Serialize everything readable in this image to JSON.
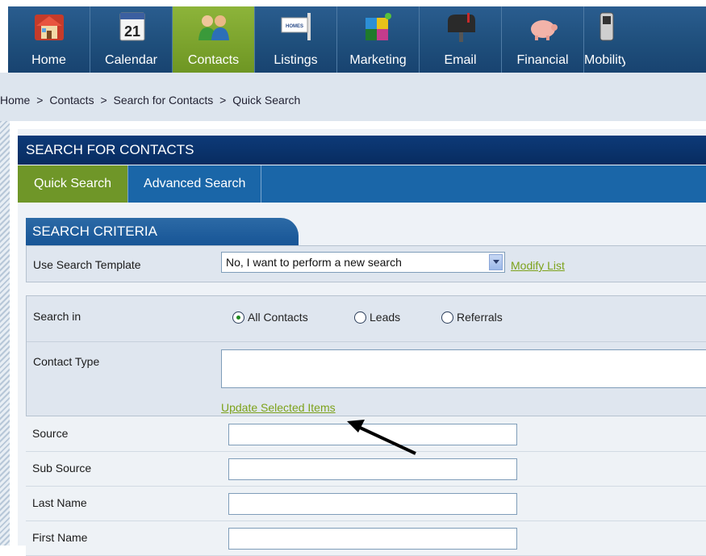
{
  "nav": [
    {
      "label": "Home",
      "icon": "house-icon"
    },
    {
      "label": "Calendar",
      "icon": "calendar-icon",
      "badge": "21"
    },
    {
      "label": "Contacts",
      "icon": "people-icon",
      "active": true
    },
    {
      "label": "Listings",
      "icon": "homes-sign-icon",
      "sign_text": "HOMES"
    },
    {
      "label": "Marketing",
      "icon": "puzzle-icon"
    },
    {
      "label": "Email",
      "icon": "mailbox-icon"
    },
    {
      "label": "Financial",
      "icon": "piggy-bank-icon"
    },
    {
      "label": "Mobility",
      "icon": "phone-icon"
    }
  ],
  "breadcrumb": [
    "Home",
    "Contacts",
    "Search for Contacts",
    "Quick Search"
  ],
  "breadcrumb_sep": ">",
  "panel": {
    "title": "SEARCH FOR CONTACTS",
    "tabs": [
      {
        "label": "Quick Search",
        "active": true
      },
      {
        "label": "Advanced Search",
        "active": false
      }
    ]
  },
  "criteria": {
    "title": "SEARCH CRITERIA",
    "template_label": "Use Search Template",
    "template_value": "No, I want to perform a new search",
    "modify_link": "Modify List",
    "search_in_label": "Search in",
    "search_options": [
      {
        "label": "All Contacts",
        "checked": true
      },
      {
        "label": "Leads",
        "checked": false
      },
      {
        "label": "Referrals",
        "checked": false
      }
    ],
    "contact_type_label": "Contact Type",
    "update_link": "Update Selected Items",
    "fields": [
      {
        "label": "Source",
        "value": ""
      },
      {
        "label": "Sub Source",
        "value": ""
      },
      {
        "label": "Last Name",
        "value": ""
      },
      {
        "label": "First Name",
        "value": ""
      }
    ]
  },
  "colors": {
    "nav_bg": "#1f4f7c",
    "active_green": "#7aa12b",
    "header_navy": "#0a3470",
    "tab_blue": "#1a66a8",
    "link_green": "#7da21b"
  }
}
